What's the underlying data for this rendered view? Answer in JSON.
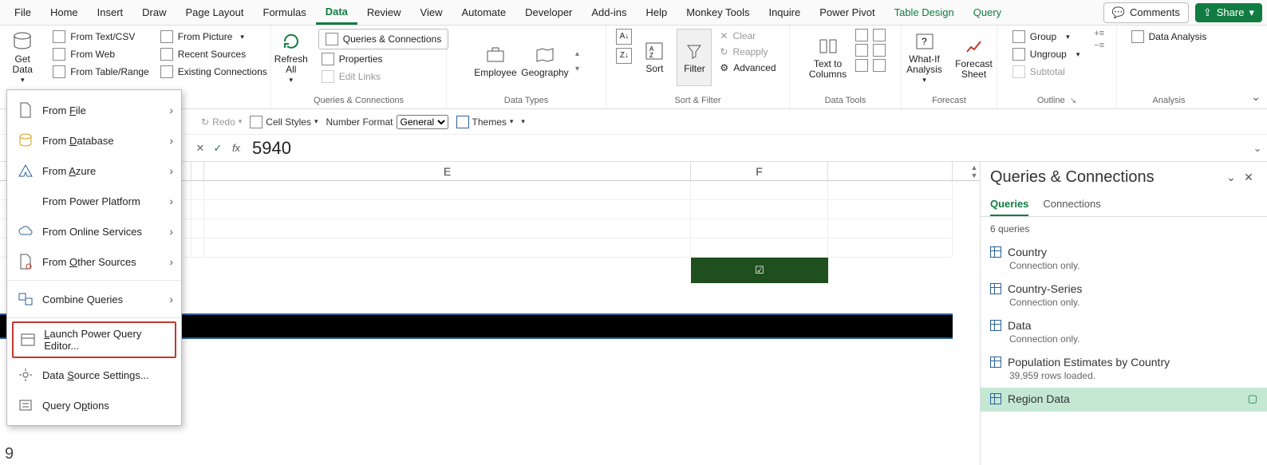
{
  "menu": {
    "file": "File",
    "home": "Home",
    "insert": "Insert",
    "draw": "Draw",
    "page_layout": "Page Layout",
    "formulas": "Formulas",
    "data": "Data",
    "review": "Review",
    "view": "View",
    "automate": "Automate",
    "developer": "Developer",
    "addins": "Add-ins",
    "help": "Help",
    "monkey": "Monkey Tools",
    "inquire": "Inquire",
    "powerpivot": "Power Pivot",
    "tabledesign": "Table Design",
    "query": "Query",
    "comments": "Comments",
    "share": "Share"
  },
  "ribbon": {
    "get_data": "Get\nData",
    "from_textcsv": "From Text/CSV",
    "from_web": "From Web",
    "from_table": "From Table/Range",
    "from_picture": "From Picture",
    "recent_sources": "Recent Sources",
    "existing_conn": "Existing Connections",
    "refresh_all": "Refresh\nAll",
    "queries_conn": "Queries & Connections",
    "properties": "Properties",
    "edit_links": "Edit Links",
    "grp_qc": "Queries & Connections",
    "employee": "Employee",
    "geography": "Geography",
    "grp_dt": "Data Types",
    "sort": "Sort",
    "filter": "Filter",
    "clear": "Clear",
    "reapply": "Reapply",
    "advanced": "Advanced",
    "grp_sf": "Sort & Filter",
    "text_to_cols": "Text to\nColumns",
    "grp_dtools": "Data Tools",
    "whatif": "What-If\nAnalysis",
    "forecast_sheet": "Forecast\nSheet",
    "grp_forecast": "Forecast",
    "group": "Group",
    "ungroup": "Ungroup",
    "subtotal": "Subtotal",
    "grp_outline": "Outline",
    "data_analysis": "Data Analysis",
    "grp_analysis": "Analysis"
  },
  "qat": {
    "redo": "Redo",
    "cell_styles": "Cell Styles",
    "number_format_label": "Number Format",
    "number_format_value": "General",
    "themes": "Themes"
  },
  "formula_bar": {
    "value": "5940"
  },
  "columns": {
    "e": "E",
    "f": "F"
  },
  "getdata_menu": {
    "from_file": "From File",
    "from_database": "From Database",
    "from_azure": "From Azure",
    "from_power_platform": "From Power Platform",
    "from_online": "From Online Services",
    "from_other": "From Other Sources",
    "combine": "Combine Queries",
    "launch_pq": "Launch Power Query Editor...",
    "ds_settings": "Data Source Settings...",
    "query_options": "Query Options"
  },
  "panel": {
    "title": "Queries & Connections",
    "tab_queries": "Queries",
    "tab_connections": "Connections",
    "count_text": "6 queries",
    "queries": [
      {
        "name": "Country",
        "sub": "Connection only."
      },
      {
        "name": "Country-Series",
        "sub": "Connection only."
      },
      {
        "name": "Data",
        "sub": "Connection only."
      },
      {
        "name": "Population Estimates by Country",
        "sub": "39,959 rows loaded."
      },
      {
        "name": "Region Data",
        "sub": ""
      }
    ]
  },
  "selected_cell_glyph": "☑",
  "rowhead": "9"
}
